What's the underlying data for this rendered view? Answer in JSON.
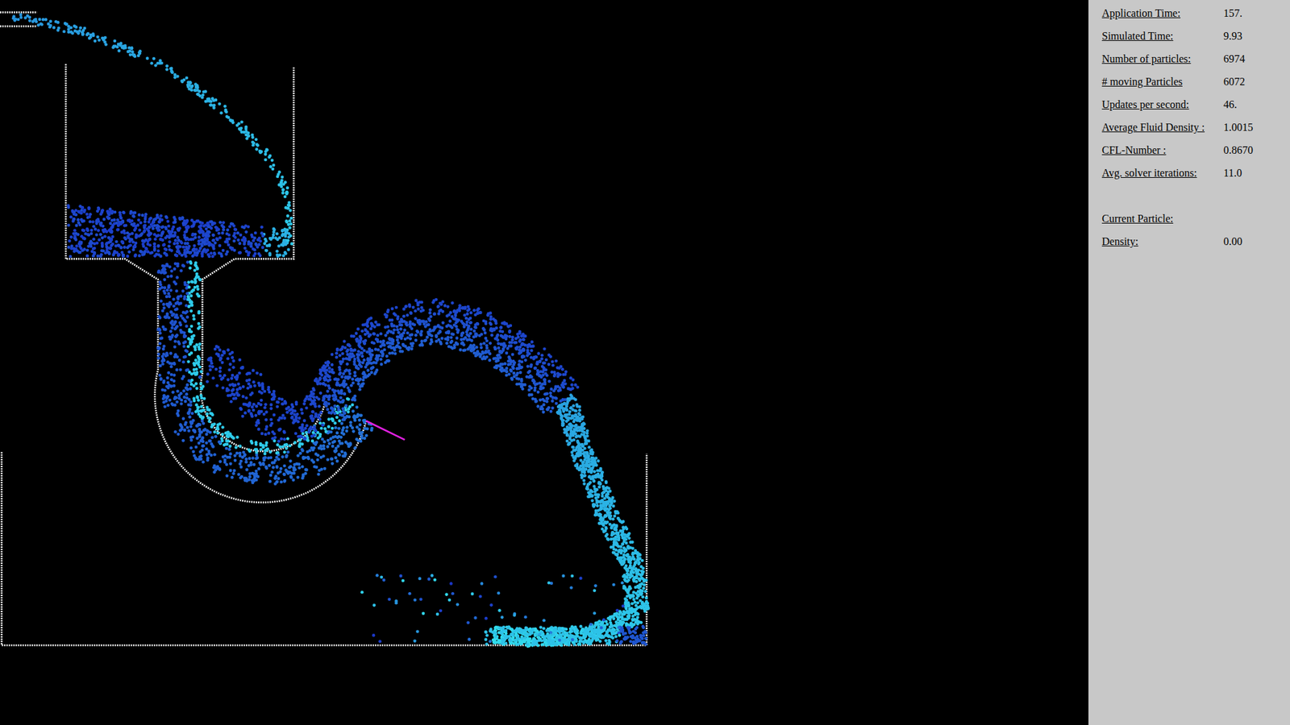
{
  "stats": [
    {
      "label": "Application Time:",
      "value": "157."
    },
    {
      "label": "Simulated Time:",
      "value": "9.93"
    },
    {
      "label": "Number of particles:",
      "value": "6974"
    },
    {
      "label": "# moving Particles",
      "value": "6072"
    },
    {
      "label": "Updates per second:",
      "value": "46."
    },
    {
      "label": "Average Fluid Density :",
      "value": "1.0015"
    },
    {
      "label": "CFL-Number :",
      "value": "0.8670"
    },
    {
      "label": "Avg. solver iterations:",
      "value": "11.0"
    }
  ],
  "current_particle": {
    "title": "Current Particle:",
    "rows": [
      {
        "label": "Density:",
        "value": "0.00"
      }
    ]
  }
}
